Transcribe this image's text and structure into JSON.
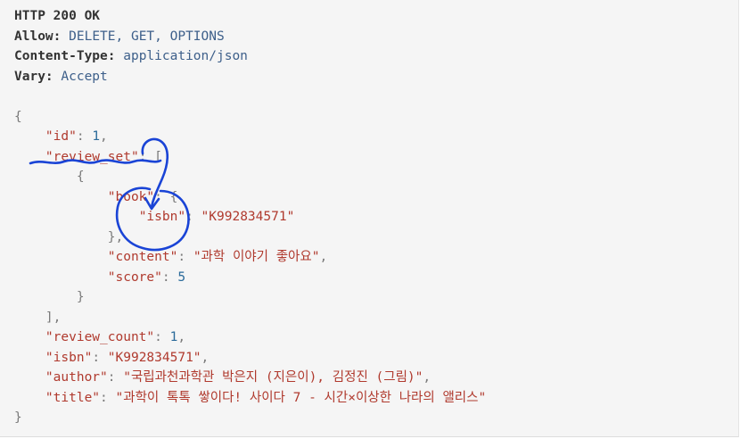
{
  "http": {
    "status": "HTTP 200 OK",
    "allow_label": "Allow:",
    "allow_value": "DELETE, GET, OPTIONS",
    "content_type_label": "Content-Type:",
    "content_type_value": "application/json",
    "vary_label": "Vary:",
    "vary_value": "Accept"
  },
  "json": {
    "open_brace": "{",
    "close_brace": "}",
    "id_key": "\"id\"",
    "id_value": "1",
    "review_set_key": "\"review_set\"",
    "review_open": "{",
    "review_close": "}",
    "book_key": "\"book\"",
    "book_close": "},",
    "isbn_key": "\"isbn\"",
    "review_isbn_value": "\"K992834571\"",
    "content_key": "\"content\"",
    "content_value": "\"과학 이야기 좋아요\"",
    "score_key": "\"score\"",
    "score_value": "5",
    "array_close": "],",
    "review_count_key": "\"review_count\"",
    "review_count_value": "1",
    "isbn_value": "\"K992834571\"",
    "author_key": "\"author\"",
    "author_value": "\"국립과천과학관 박은지 (지은이), 김정진 (그림)\"",
    "title_key": "\"title\"",
    "title_value": "\"과학이 톡톡 쌓이다! 사이다 7 - 시간×이상한 나라의 앨리스\""
  },
  "annotation": {
    "color": "#1a44d6"
  }
}
